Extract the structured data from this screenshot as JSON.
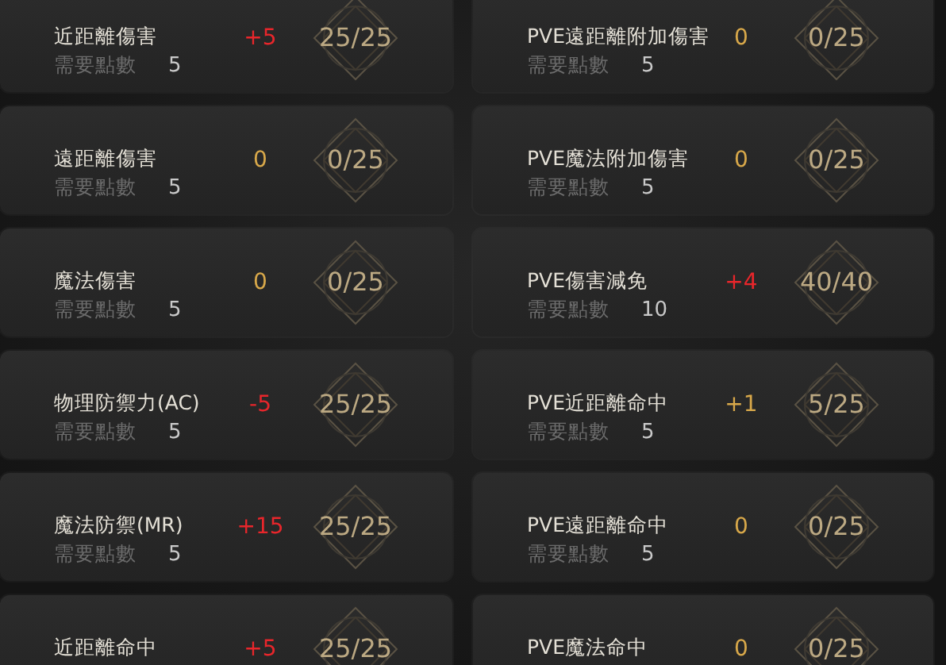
{
  "stats": [
    {
      "name": "近距離傷害",
      "bonus": "+5",
      "color": "#e8262b",
      "progress": "25/25",
      "cost_label": "需要點數",
      "cost": "5"
    },
    {
      "name": "PVE遠距離附加傷害",
      "bonus": "0",
      "color": "#d8a84a",
      "progress": "0/25",
      "cost_label": "需要點數",
      "cost": "5"
    },
    {
      "name": "遠距離傷害",
      "bonus": "0",
      "color": "#d8a84a",
      "progress": "0/25",
      "cost_label": "需要點數",
      "cost": "5"
    },
    {
      "name": "PVE魔法附加傷害",
      "bonus": "0",
      "color": "#d8a84a",
      "progress": "0/25",
      "cost_label": "需要點數",
      "cost": "5"
    },
    {
      "name": "魔法傷害",
      "bonus": "0",
      "color": "#d8a84a",
      "progress": "0/25",
      "cost_label": "需要點數",
      "cost": "5"
    },
    {
      "name": "PVE傷害減免",
      "bonus": "+4",
      "color": "#e8262b",
      "progress": "40/40",
      "cost_label": "需要點數",
      "cost": "10"
    },
    {
      "name": "物理防禦力(AC)",
      "bonus": "-5",
      "color": "#e8262b",
      "progress": "25/25",
      "cost_label": "需要點數",
      "cost": "5"
    },
    {
      "name": "PVE近距離命中",
      "bonus": "+1",
      "color": "#d8a84a",
      "progress": "5/25",
      "cost_label": "需要點數",
      "cost": "5"
    },
    {
      "name": "魔法防禦(MR)",
      "bonus": "+15",
      "color": "#e8262b",
      "progress": "25/25",
      "cost_label": "需要點數",
      "cost": "5"
    },
    {
      "name": "PVE遠距離命中",
      "bonus": "0",
      "color": "#d8a84a",
      "progress": "0/25",
      "cost_label": "需要點數",
      "cost": "5"
    },
    {
      "name": "近距離命中",
      "bonus": "+5",
      "color": "#e8262b",
      "progress": "25/25"
    },
    {
      "name": "PVE魔法命中",
      "bonus": "0",
      "color": "#d8a84a",
      "progress": "0/25"
    }
  ]
}
